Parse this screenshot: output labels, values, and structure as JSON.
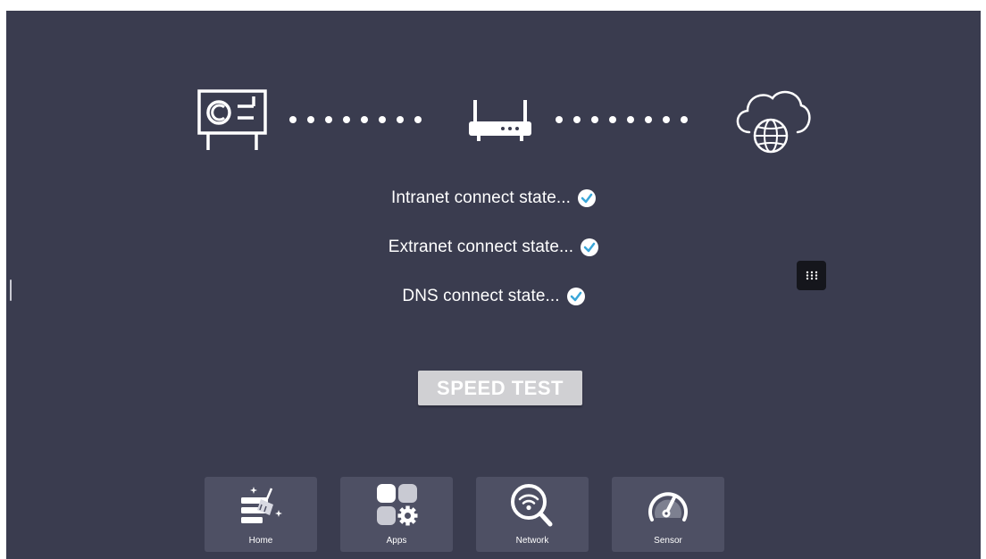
{
  "topology": {
    "nodes": [
      {
        "icon": "display-panel-icon"
      },
      {
        "icon": "router-icon"
      },
      {
        "icon": "cloud-globe-icon"
      }
    ]
  },
  "states": [
    {
      "label": "Intranet connect state...",
      "status": "ok",
      "icon": "check-circle-icon"
    },
    {
      "label": "Extranet connect state...",
      "status": "ok",
      "icon": "check-circle-icon"
    },
    {
      "label": "DNS connect state...",
      "status": "ok",
      "icon": "check-circle-icon"
    }
  ],
  "speed_test": {
    "label": "SPEED TEST"
  },
  "dock": [
    {
      "label": "Home",
      "icon": "cleanup-broom-icon"
    },
    {
      "label": "Apps",
      "icon": "apps-gear-icon"
    },
    {
      "label": "Network",
      "icon": "wifi-search-icon"
    },
    {
      "label": "Sensor",
      "icon": "speedometer-icon"
    }
  ],
  "colors": {
    "background": "#3a3c4f",
    "check_accent": "#3aa6d8",
    "button": "#d0d0d3",
    "dock_tile": "#4e5064"
  }
}
